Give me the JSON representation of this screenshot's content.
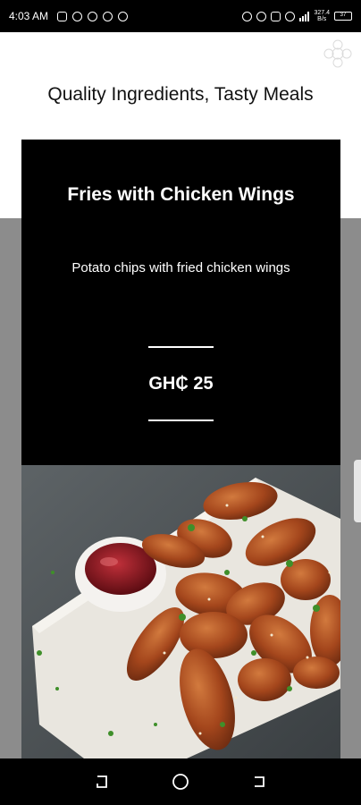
{
  "status_bar": {
    "time": "4:03 AM",
    "left_icons": [
      "instagram-icon",
      "shield-icon",
      "heart-icon",
      "alarm-icon",
      "globe-icon"
    ],
    "right_icons": [
      "alarm-icon",
      "headset-icon",
      "notification-icon",
      "wifi-icon",
      "signal-icon"
    ],
    "net_speed": "327.4",
    "net_unit": "B/s",
    "battery": "37"
  },
  "page": {
    "headline": "Quality Ingredients, Tasty Meals"
  },
  "menu_item": {
    "title": "Fries with Chicken Wings",
    "description": "Potato chips with fried chicken wings",
    "price": "GH₵ 25",
    "image": "chicken-wings-photo"
  },
  "nav_bar": {
    "buttons": [
      "recent-apps-icon",
      "home-icon",
      "back-icon"
    ]
  },
  "colors": {
    "card_background": "#000000",
    "page_background": "#ffffff",
    "gray_band": "#8c8c8c",
    "text_on_card": "#ffffff"
  }
}
